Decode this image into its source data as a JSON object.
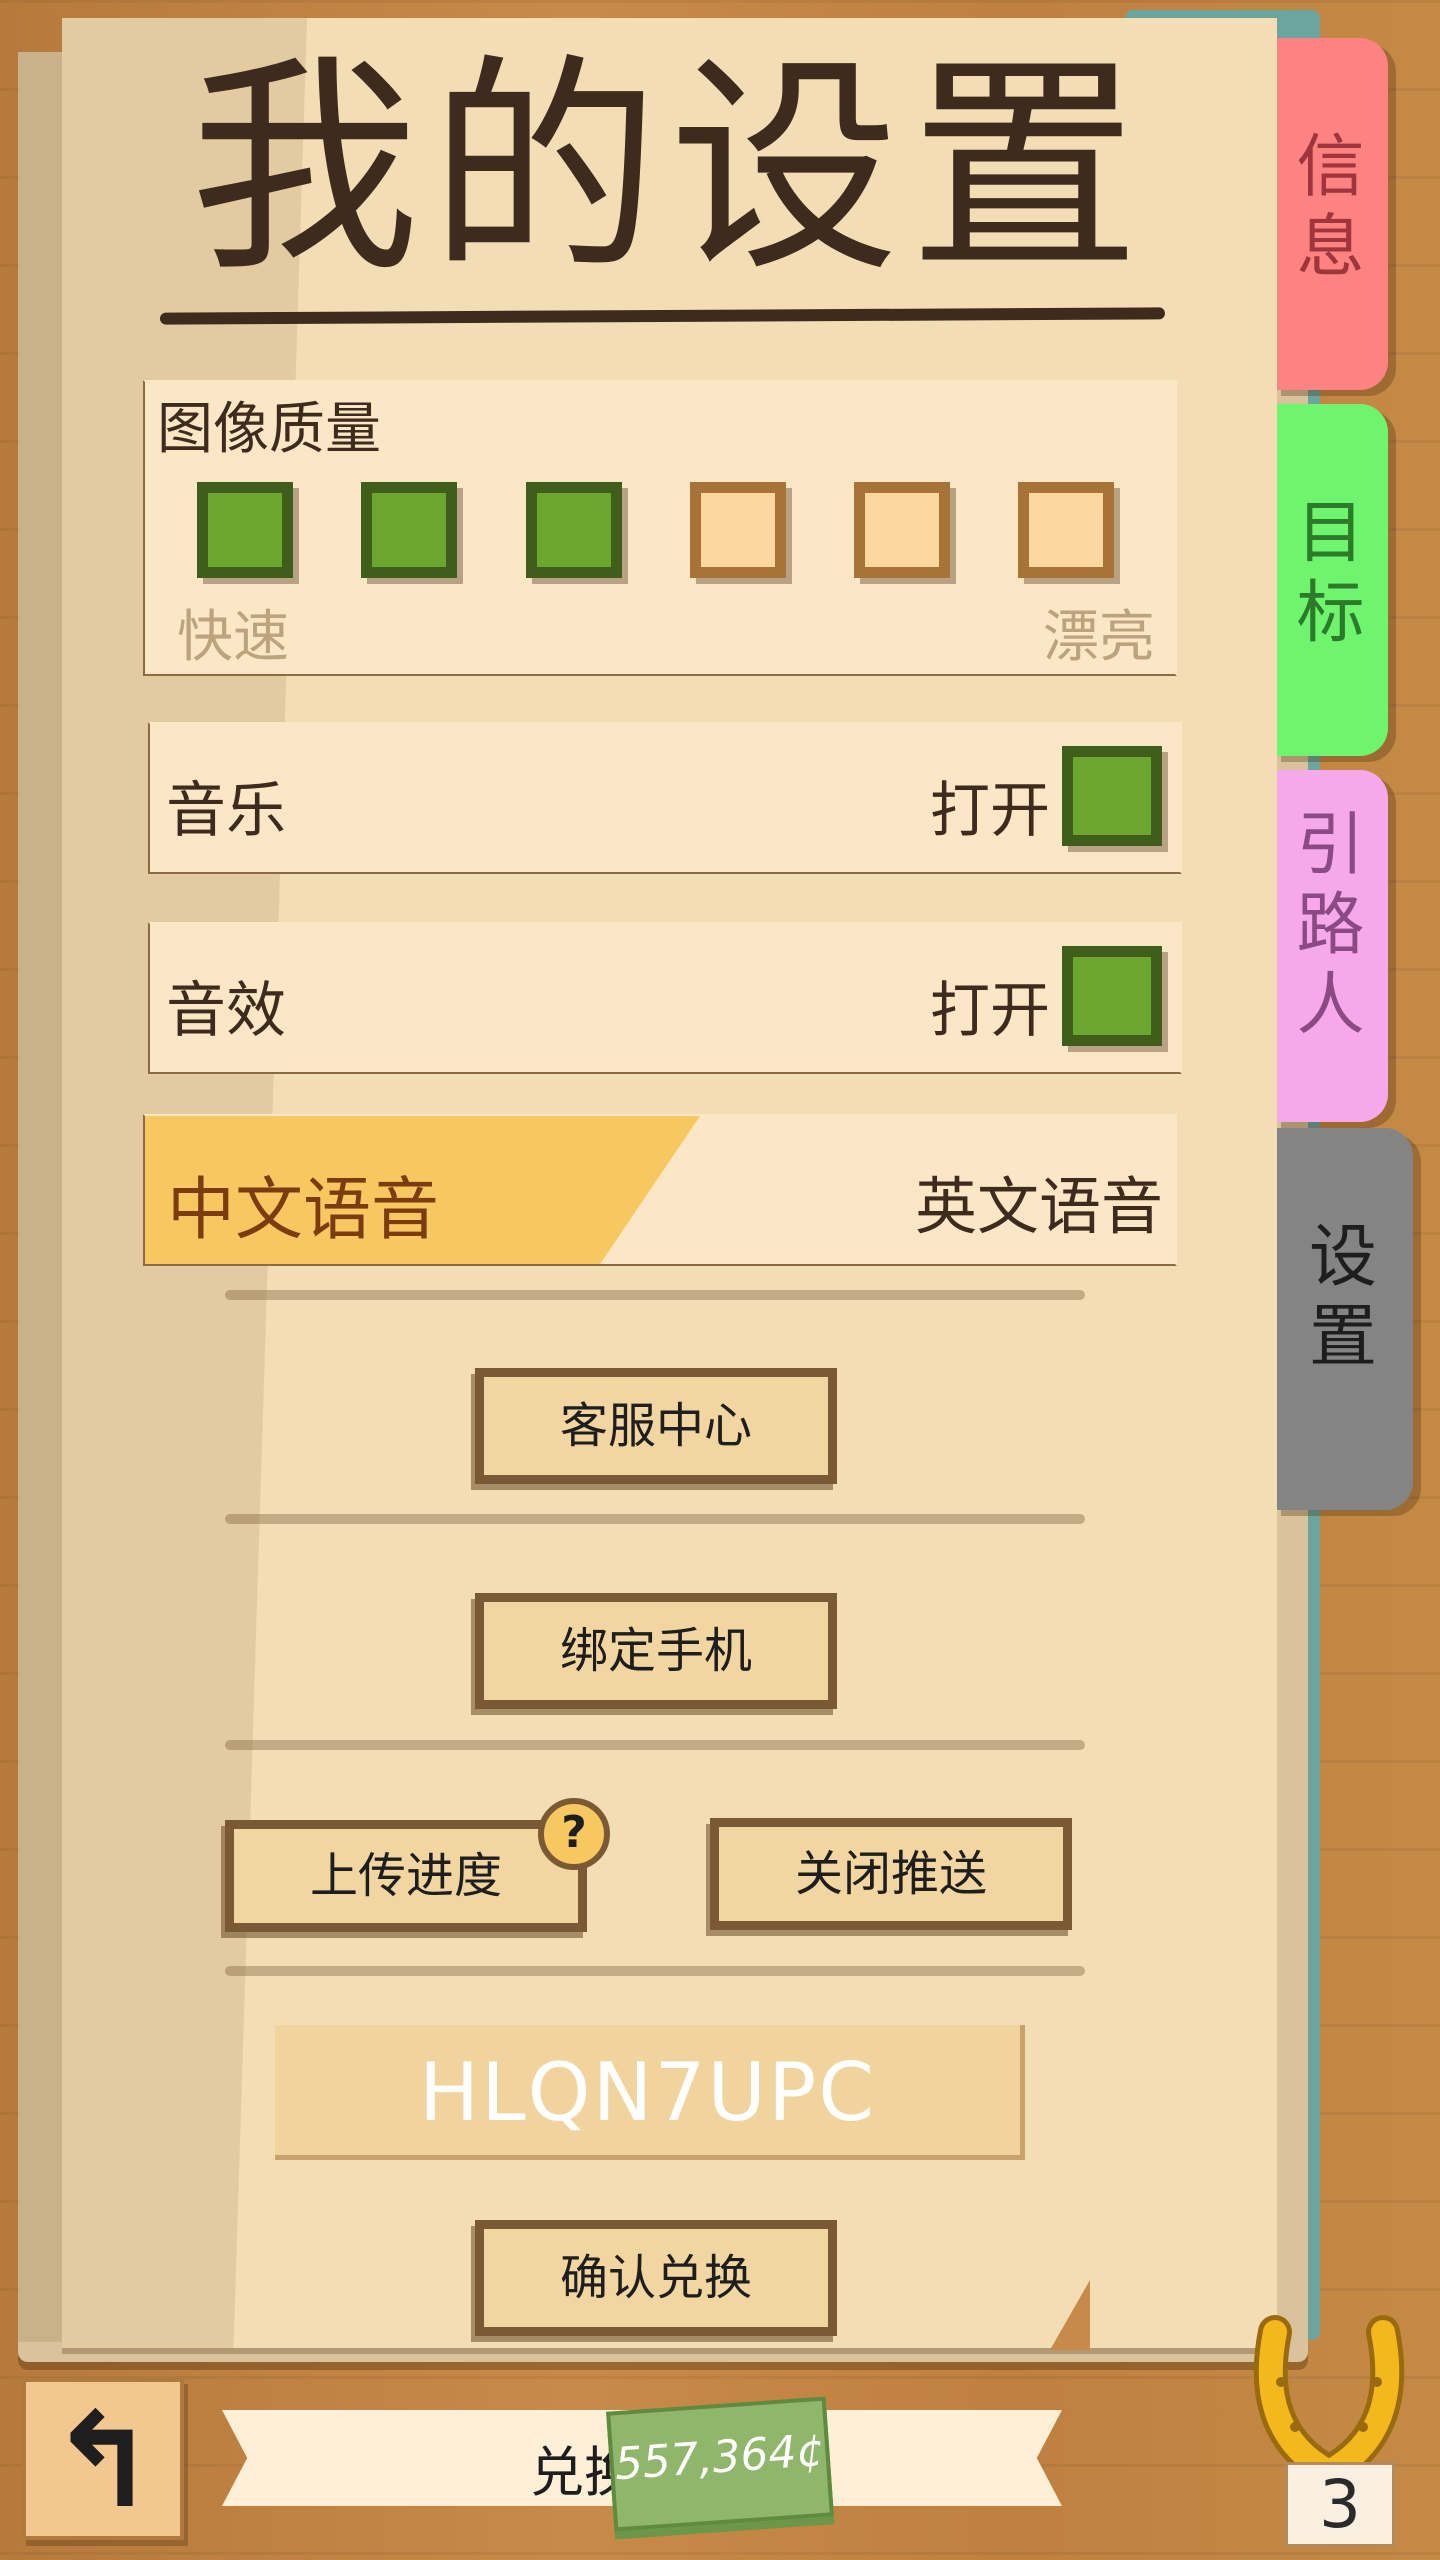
{
  "page": {
    "title": "我的设置"
  },
  "graphics": {
    "label": "图像质量",
    "levels": [
      true,
      true,
      true,
      false,
      false,
      false
    ],
    "low_label": "快速",
    "high_label": "漂亮"
  },
  "music": {
    "label": "音乐",
    "state": "打开"
  },
  "sound_effects": {
    "label": "音效",
    "state": "打开"
  },
  "voice": {
    "selected": "中文语音",
    "other": "英文语音"
  },
  "buttons": {
    "support": "客服中心",
    "bind_phone": "绑定手机",
    "upload_progress": "上传进度",
    "help_badge": "?",
    "close_push": "关闭推送",
    "confirm_redeem": "确认兑换"
  },
  "redeem_code": "HLQN7UPC",
  "tabs": [
    {
      "label": "信\n息",
      "color": "#fd8383"
    },
    {
      "label": "目\n标",
      "color": "#6ef56d"
    },
    {
      "label": "引\n路\n人",
      "color": "#f5a9ea"
    },
    {
      "label": "设\n置",
      "color": "#848484",
      "active": true
    }
  ],
  "bottom": {
    "ribbon_label": "兑换",
    "cash": "557,364¢",
    "level": "3"
  },
  "colors": {
    "checkbox_on": "#6ba62f",
    "checkbox_off": "#fdd7a0",
    "voice_selected": "#f8c860"
  }
}
